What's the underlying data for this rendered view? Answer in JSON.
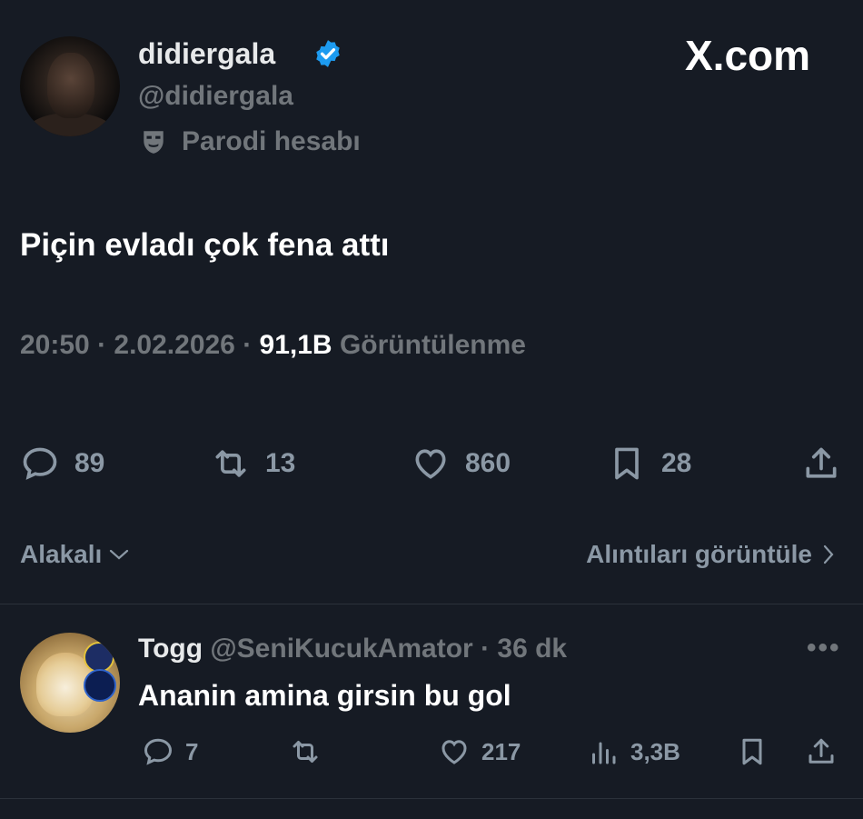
{
  "tweet": {
    "display_name": "didiergala",
    "handle": "@didiergala",
    "parody_label": "Parodi hesabı",
    "brand": "X.com",
    "text": "Piçin evladı çok fena attı",
    "time": "20:50",
    "date": "2.02.2026",
    "views_count": "91,1B",
    "views_label": "Görüntülenme",
    "actions": {
      "replies": "89",
      "reposts": "13",
      "likes": "860",
      "bookmarks": "28"
    },
    "icons": [
      "reply-icon",
      "repost-icon",
      "like-icon",
      "bookmark-icon",
      "share-icon",
      "verified-icon",
      "parody-mask-icon"
    ]
  },
  "filters": {
    "sort_label": "Alakalı",
    "quotes_label": "Alıntıları görüntüle"
  },
  "reply": {
    "display_name": "Togg",
    "handle": "@SeniKucukAmator",
    "time": "36 dk",
    "text": "Ananin amina girsin bu gol",
    "actions": {
      "replies": "7",
      "likes": "217",
      "views": "3,3B"
    }
  },
  "colors": {
    "background": "#161b24",
    "primary_text": "#e7e9ea",
    "muted_text": "#71767b",
    "verified_blue": "#1d9bf0"
  }
}
